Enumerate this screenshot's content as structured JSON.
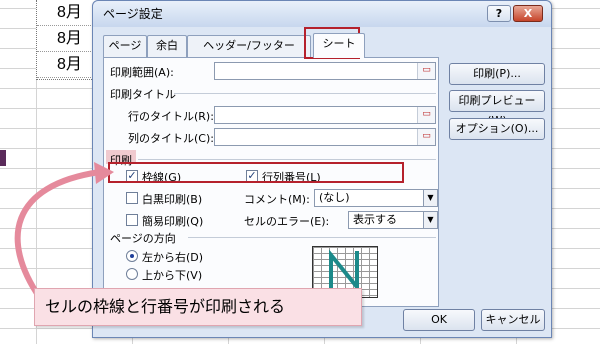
{
  "sheet": {
    "cells": [
      "8月",
      "8月",
      "8月"
    ]
  },
  "dialog": {
    "title": "ページ設定",
    "help": "?",
    "close": "X",
    "tabs": [
      "ページ",
      "余白",
      "ヘッダー/フッター",
      "シート"
    ],
    "print_area_label": "印刷範囲(A):",
    "print_titles_section": "印刷タイトル",
    "rows_title_label": "行のタイトル(R):",
    "cols_title_label": "列のタイトル(C):",
    "print_section": "印刷",
    "gridlines_label": "枠線(G)",
    "row_col_headers_label": "行列番号(L)",
    "bw_label": "白黒印刷(B)",
    "draft_label": "簡易印刷(Q)",
    "comments_label": "コメント(M):",
    "comments_value": "(なし)",
    "cell_errors_label": "セルのエラー(E):",
    "cell_errors_value": "表示する",
    "page_order_section": "ページの方向",
    "order_lr_label": "左から右(D)",
    "order_td_label": "上から下(V)",
    "print_button": "印刷(P)...",
    "preview_button": "印刷プレビュー(W)",
    "options_button": "オプション(O)...",
    "ok_button": "OK",
    "cancel_button": "キャンセル",
    "checks": {
      "gridlines": true,
      "row_col_headers": true,
      "bw": false,
      "draft": false
    },
    "page_order": "left-to-right"
  },
  "callout": {
    "text": "セルの枠線と行番号が印刷される"
  },
  "colors": {
    "highlight": "#b5212c",
    "callout_bg": "#fae0e5",
    "arrow": "#e58a9c"
  }
}
